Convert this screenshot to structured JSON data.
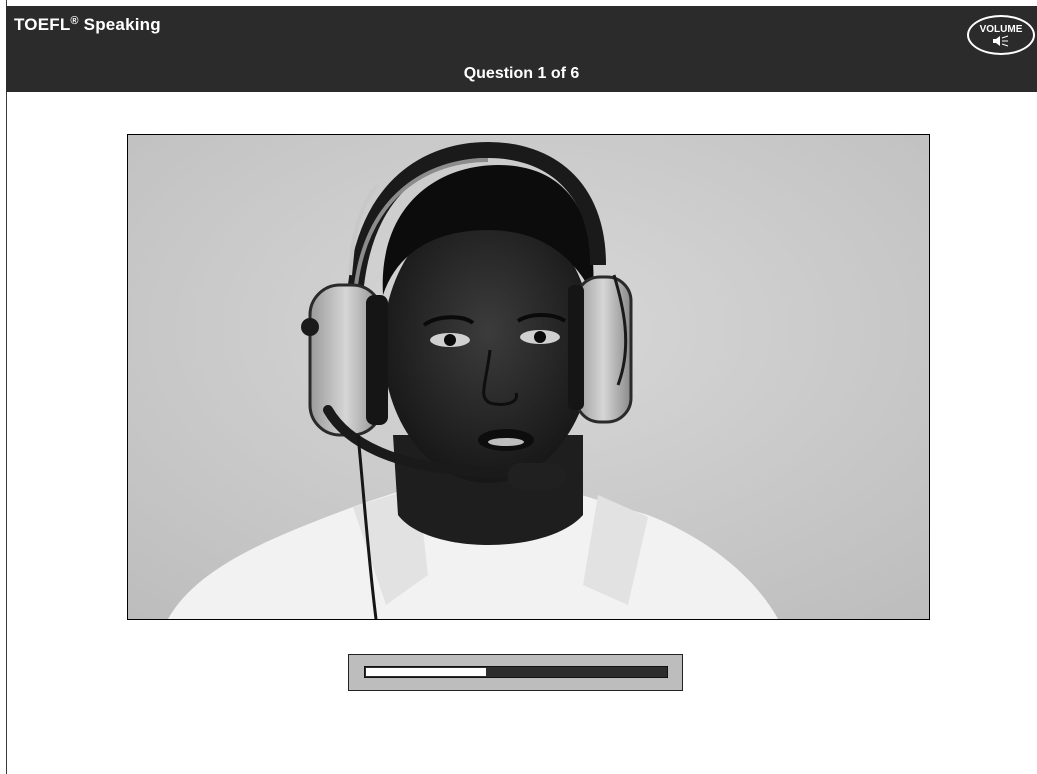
{
  "header": {
    "app_name": "TOEFL",
    "app_name_mark": "®",
    "app_name_suffix": " Speaking",
    "question_counter": "Question 1 of 6",
    "volume_label": "VOLUME",
    "volume_icon": "speaker-icon"
  },
  "photo": {
    "alt": "man wearing aviation headset with boom microphone"
  },
  "progress": {
    "value": 0.4,
    "accent": "#ffffff",
    "track": "#2d2d2d"
  },
  "colors": {
    "header_bg": "#2b2b2b",
    "header_text": "#ffffff",
    "panel_bg": "#bdbdbd"
  }
}
